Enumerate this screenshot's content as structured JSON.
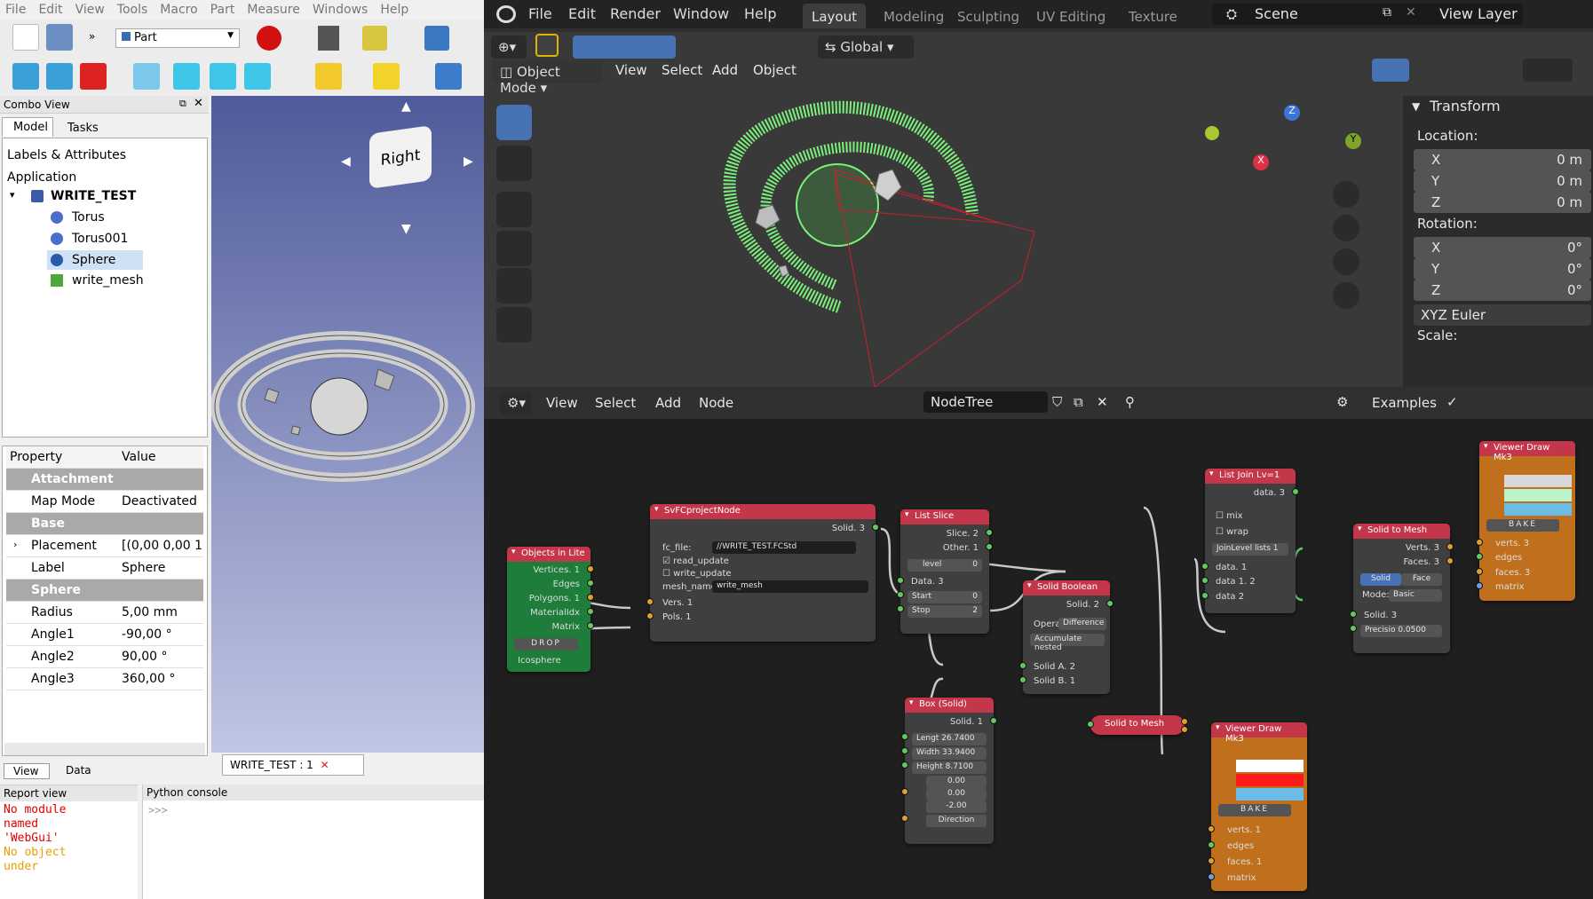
{
  "freecad": {
    "menu": [
      "File",
      "Edit",
      "View",
      "Tools",
      "Macro",
      "Part",
      "Measure",
      "Windows",
      "Help"
    ],
    "workbench": "Part",
    "combo_view": {
      "title": "Combo View",
      "tabs": [
        "Model",
        "Tasks"
      ],
      "labels_header": "Labels & Attributes",
      "application": "Application",
      "tree": {
        "root": "WRITE_TEST",
        "items": [
          "Torus",
          "Torus001",
          "Sphere",
          "write_mesh"
        ]
      }
    },
    "nav_cube_face": "Right",
    "property": {
      "headers": [
        "Property",
        "Value"
      ],
      "rows": [
        {
          "group": "Attachment"
        },
        {
          "name": "Map Mode",
          "value": "Deactivated"
        },
        {
          "group": "Base"
        },
        {
          "name": "Placement",
          "value": "[(0,00 0,00 1,00"
        },
        {
          "name": "Label",
          "value": "Sphere"
        },
        {
          "group": "Sphere"
        },
        {
          "name": "Radius",
          "value": "5,00 mm"
        },
        {
          "name": "Angle1",
          "value": "-90,00 °"
        },
        {
          "name": "Angle2",
          "value": "90,00 °"
        },
        {
          "name": "Angle3",
          "value": "360,00 °"
        }
      ]
    },
    "bottom_tabs": [
      "View",
      "Data"
    ],
    "doc_tab": "WRITE_TEST : 1",
    "report_view": {
      "title": "Report view",
      "lines": [
        "No module",
        "named",
        "'WebGui'",
        "No object",
        "under"
      ]
    },
    "python_console": {
      "title": "Python console",
      "prompt": ">>>"
    }
  },
  "blender": {
    "menu": [
      "File",
      "Edit",
      "Render",
      "Window",
      "Help"
    ],
    "workspaces": [
      "Layout",
      "Modeling",
      "Sculpting",
      "UV Editing",
      "Texture Pa"
    ],
    "scene": "Scene",
    "view_layer": "View Layer",
    "viewport": {
      "mode": "Object Mode",
      "menus": [
        "View",
        "Select",
        "Add",
        "Object"
      ],
      "orientation": "Global"
    },
    "transform": {
      "title": "Transform",
      "location_label": "Location:",
      "location": [
        {
          "axis": "X",
          "value": "0 m"
        },
        {
          "axis": "Y",
          "value": "0 m"
        },
        {
          "axis": "Z",
          "value": "0 m"
        }
      ],
      "rotation_label": "Rotation:",
      "rotation": [
        {
          "axis": "X",
          "value": "0°"
        },
        {
          "axis": "Y",
          "value": "0°"
        },
        {
          "axis": "Z",
          "value": "0°"
        }
      ],
      "euler": "XYZ Euler",
      "scale_label": "Scale:"
    },
    "node_editor": {
      "menus": [
        "View",
        "Select",
        "Add",
        "Node"
      ],
      "tree": "NodeTree",
      "examples": "Examples"
    },
    "nodes": {
      "objects_lite": {
        "title": "Objects in Lite",
        "outs": [
          "Vertices. 1",
          "Edges",
          "Polygons. 1",
          "MaterialIdx",
          "Matrix"
        ],
        "btn": "DROP",
        "obj": "Icosphere"
      },
      "fc_project": {
        "title": "SvFCprojectNode",
        "out": "Solid. 3",
        "fc_file_label": "fc_file:",
        "fc_file": "//WRITE_TEST.FCStd",
        "read": "read_update",
        "write": "write_update",
        "mesh_label": "mesh_name:",
        "mesh": "write_mesh",
        "ins": [
          "Vers. 1",
          "Pols. 1"
        ]
      },
      "list_slice": {
        "title": "List Slice",
        "outs": [
          "Slice. 2",
          "Other. 1"
        ],
        "level_label": "level",
        "level": "0",
        "data": "Data. 3",
        "start_label": "Start",
        "start": "0",
        "stop_label": "Stop",
        "stop": "2"
      },
      "solid_boolean": {
        "title": "Solid Boolean",
        "out": "Solid. 2",
        "op_label": "Opera",
        "op": "Difference",
        "accum": "Accumulate nested",
        "ins": [
          "Solid A. 2",
          "Solid B. 1"
        ]
      },
      "list_join": {
        "title": "List Join Lv=1",
        "out": "data. 3",
        "mix": "mix",
        "wrap": "wrap",
        "join": "JoinLevel lists",
        "join_val": "1",
        "ins": [
          "data. 1",
          "data 1. 2",
          "data 2"
        ]
      },
      "solid_to_mesh_a": {
        "title": "Solid to Mesh",
        "outs": [
          "Verts. 3",
          "Faces. 3"
        ],
        "tabs": [
          "Solid",
          "Face"
        ],
        "mode_label": "Mode:",
        "mode": "Basic",
        "in": "Solid. 3",
        "precision": "Precisio 0.0500"
      },
      "viewer_a": {
        "title": "Viewer Draw Mk3",
        "bake": "BAKE",
        "ins": [
          "verts. 3",
          "edges",
          "faces. 3",
          "matrix"
        ]
      },
      "box_solid": {
        "title": "Box (Solid)",
        "out": "Solid. 1",
        "fields": [
          "Lengt 26.7400",
          "Width 33.9400",
          "Height 8.7100",
          "0.00",
          "0.00",
          "-2.00"
        ],
        "dir": "Direction"
      },
      "solid_to_mesh_b": {
        "title": "Solid to Mesh"
      },
      "viewer_b": {
        "title": "Viewer Draw Mk3",
        "bake": "BAKE",
        "ins": [
          "verts. 1",
          "edges",
          "faces. 1",
          "matrix"
        ]
      }
    }
  },
  "colors": {
    "blender_accent": "#4772b3",
    "node_red": "#c4374b",
    "node_green": "#1e7d3b",
    "node_orange": "#c06f1d",
    "wire_green": "#7cf07c",
    "wire_red": "#c8202e"
  }
}
